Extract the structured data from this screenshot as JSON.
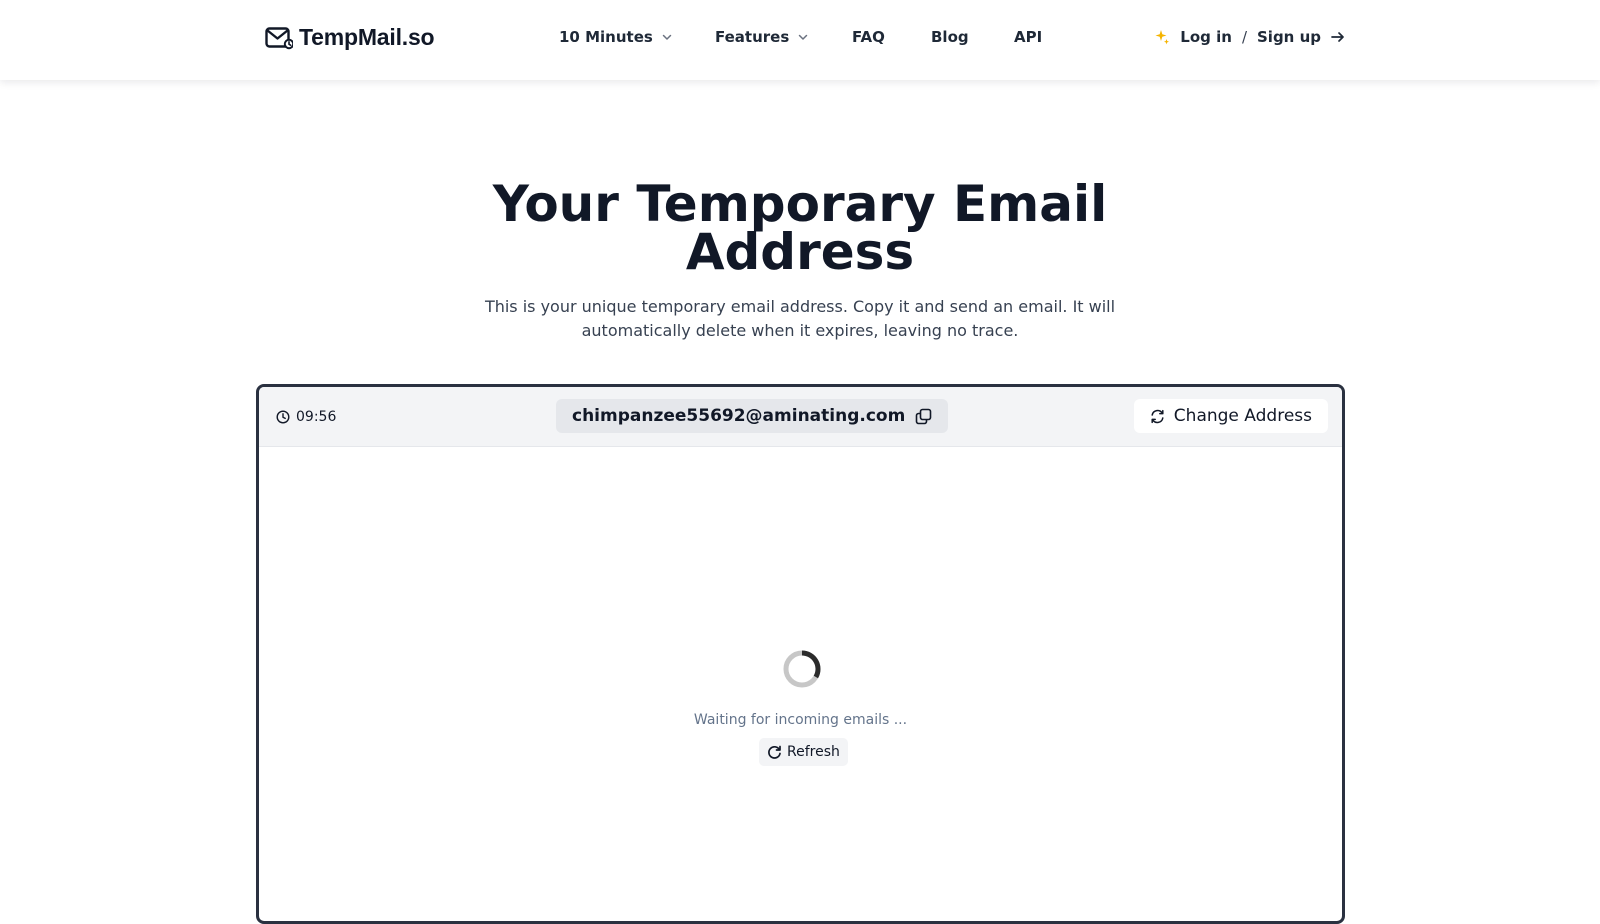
{
  "header": {
    "logo_text": "TempMail.so",
    "nav": [
      {
        "label": "10 Minutes",
        "has_dropdown": true
      },
      {
        "label": "Features",
        "has_dropdown": true
      },
      {
        "label": "FAQ",
        "has_dropdown": false
      },
      {
        "label": "Blog",
        "has_dropdown": false
      },
      {
        "label": "API",
        "has_dropdown": false
      }
    ],
    "auth": {
      "login_label": "Log in",
      "separator": "/",
      "signup_label": "Sign up",
      "icon": "sparkle-icon",
      "icon_color": "#f5b400"
    }
  },
  "hero": {
    "title_line1": "Your Temporary Email",
    "title_line2": "Address",
    "subtitle": "This is your unique temporary email address. Copy it and send an email. It will automatically delete when it expires, leaving no trace."
  },
  "mailbox": {
    "timer": "09:56",
    "address": "chimpanzee55692@aminating.com",
    "change_label": "Change Address",
    "waiting_text": "Waiting for incoming emails ...",
    "refresh_label": "Refresh"
  },
  "colors": {
    "panel_border": "#2a3140",
    "bar_bg": "#f3f4f6",
    "address_bg": "#e5e7eb",
    "muted_text": "#64748b"
  }
}
